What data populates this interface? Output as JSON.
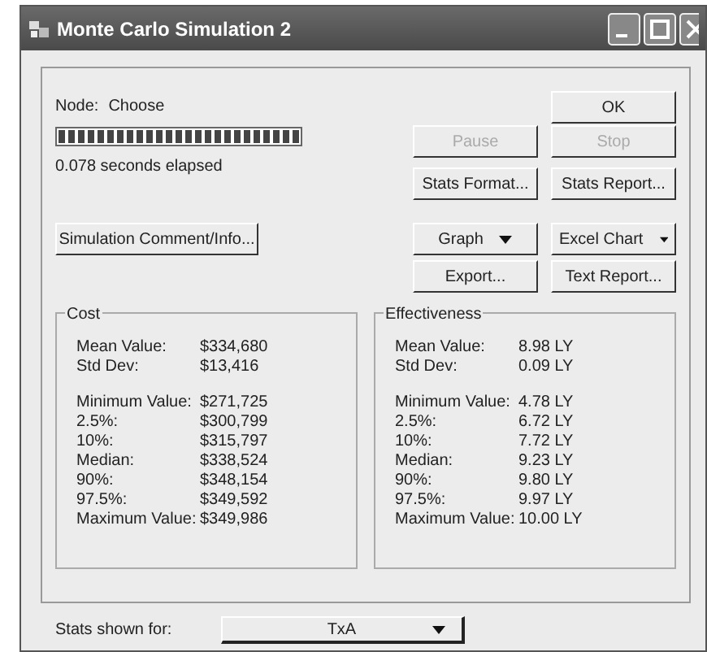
{
  "window": {
    "title": "Monte Carlo Simulation 2"
  },
  "node": {
    "label": "Node:",
    "value": "Choose"
  },
  "progress": {
    "level": 1
  },
  "elapsed": "0.078 seconds elapsed",
  "buttons": [
    {
      "label": "OK",
      "disabled": false,
      "kind": "plain"
    },
    {
      "label": "Pause",
      "disabled": true,
      "kind": "plain"
    },
    {
      "label": "Stop",
      "disabled": true,
      "kind": "plain"
    },
    {
      "label": "Stats Format...",
      "disabled": false,
      "kind": "plain"
    },
    {
      "label": "Stats Report...",
      "disabled": false,
      "kind": "plain"
    },
    {
      "label": "Simulation Comment/Info...",
      "disabled": false,
      "kind": "plain"
    },
    {
      "label": "Graph",
      "disabled": false,
      "kind": "menu"
    },
    {
      "label": "Excel Chart",
      "disabled": false,
      "kind": "menu"
    },
    {
      "label": "Export...",
      "disabled": false,
      "kind": "plain"
    },
    {
      "label": "Text Report...",
      "disabled": false,
      "kind": "plain"
    }
  ],
  "groups": [
    {
      "title": "Cost",
      "sections": [
        [
          {
            "label": "Mean Value:",
            "value": "$334,680"
          },
          {
            "label": "Std Dev:",
            "value": "$13,416"
          }
        ],
        [
          {
            "label": "Minimum Value:",
            "value": "$271,725"
          },
          {
            "label": "2.5%:",
            "value": "$300,799"
          },
          {
            "label": "10%:",
            "value": "$315,797"
          },
          {
            "label": "Median:",
            "value": "$338,524"
          },
          {
            "label": "90%:",
            "value": "$348,154"
          },
          {
            "label": "97.5%:",
            "value": "$349,592"
          },
          {
            "label": "Maximum Value:",
            "value": "$349,986"
          }
        ]
      ]
    },
    {
      "title": "Effectiveness",
      "sections": [
        [
          {
            "label": "Mean Value:",
            "value": "8.98 LY"
          },
          {
            "label": "Std Dev:",
            "value": "0.09 LY"
          }
        ],
        [
          {
            "label": "Minimum Value:",
            "value": "4.78 LY"
          },
          {
            "label": "2.5%:",
            "value": "6.72 LY"
          },
          {
            "label": "10%:",
            "value": "7.72 LY"
          },
          {
            "label": "Median:",
            "value": "9.23 LY"
          },
          {
            "label": "90%:",
            "value": "9.80 LY"
          },
          {
            "label": "97.5%:",
            "value": "9.97 LY"
          },
          {
            "label": "Maximum Value:",
            "value": "10.00 LY"
          }
        ]
      ]
    }
  ],
  "stats_for": {
    "label": "Stats shown for:",
    "value": "TxA"
  }
}
